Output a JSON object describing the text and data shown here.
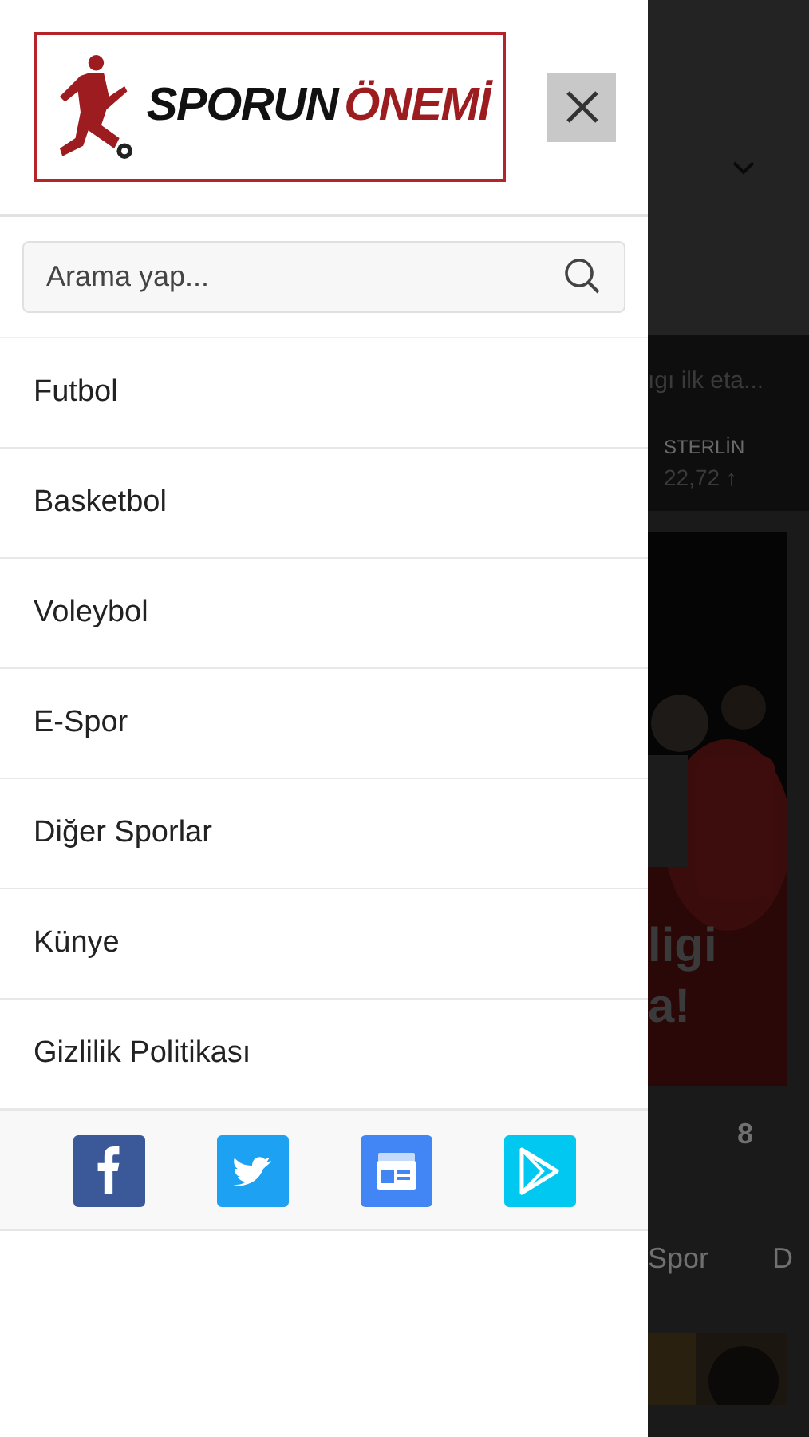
{
  "drawer": {
    "logo": {
      "word_1": "SPORUN",
      "word_2": "ÖNEMİ"
    },
    "search": {
      "placeholder": "Arama yap..."
    },
    "menu": [
      {
        "label": "Futbol"
      },
      {
        "label": "Basketbol"
      },
      {
        "label": "Voleybol"
      },
      {
        "label": "E-Spor"
      },
      {
        "label": "Diğer Sporlar"
      },
      {
        "label": "Künye"
      },
      {
        "label": "Gizlilik Politikası"
      }
    ],
    "social": [
      {
        "kind": "facebook",
        "color": "#3b5998"
      },
      {
        "kind": "twitter",
        "color": "#1da1f2"
      },
      {
        "kind": "news",
        "color": "#4285f4"
      },
      {
        "kind": "play",
        "color": "#00c8f0"
      }
    ]
  },
  "background_page": {
    "ticker": "ıgı ilk eta...",
    "currency": "STERLİN",
    "rate": "22,72 ↑",
    "headline_1": "ligi",
    "headline_2": "a!",
    "tab_1": "8",
    "tab_2": "Spor",
    "tab_3": "D"
  }
}
